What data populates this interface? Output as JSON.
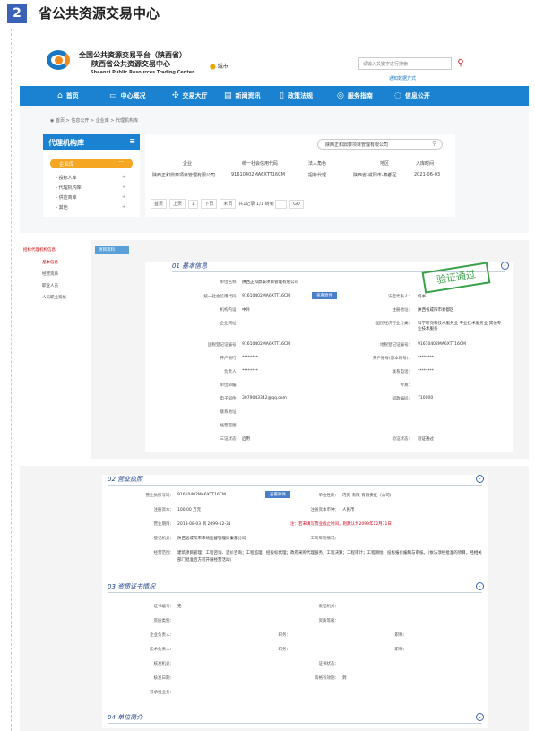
{
  "header": {
    "number": "2",
    "title": "省公共资源交易中心"
  },
  "site": {
    "org_line1": "全国公共资源交易平台（陕西省）",
    "org_line2": "陕西省公共资源交易中心",
    "org_en": "Shaanxi Public Resources Trading Center",
    "city": "城市",
    "search_placeholder": "请输入关键字进行搜索",
    "subscribe": "通知数据方式"
  },
  "nav": {
    "items": [
      {
        "icon": "home-icon",
        "label": "首页"
      },
      {
        "icon": "monitor-icon",
        "label": "中心概况"
      },
      {
        "icon": "handshake-icon",
        "label": "交易大厅"
      },
      {
        "icon": "document-icon",
        "label": "新闻资讯"
      },
      {
        "icon": "book-icon",
        "label": "政策法规"
      },
      {
        "icon": "compass-icon",
        "label": "服务指南"
      },
      {
        "icon": "chat-icon",
        "label": "信息公开"
      }
    ]
  },
  "breadcrumb": "首页 > 信息公开 > 企业库 > 代理机构库",
  "sidebar": {
    "title": "代理机构库",
    "active": "企业库",
    "items": [
      "投标人库",
      "代理机构库",
      "供应商库",
      "其他"
    ]
  },
  "list": {
    "search_value": "陕西正和鼎泰项目管理有限公司",
    "columns": [
      "企业",
      "统一社会信用代码",
      "法人角色",
      "地区",
      "入库时间"
    ],
    "row": [
      "陕西正和鼎泰项目管理有限公司",
      "91610402MA6XTT16CM",
      "招标代理",
      "陕西省-咸阳市-秦都区",
      "2021-06-03"
    ],
    "pager": [
      "首页",
      "上页",
      "1",
      "下页",
      "末页",
      "共1记录",
      "1/1",
      "转到",
      "GO"
    ]
  },
  "detail_side": {
    "title": "招标代理机构信息",
    "items": [
      "基本信息",
      "经营资质",
      "职业人员",
      "人员职业资格"
    ],
    "tab": "项目资料"
  },
  "basic": {
    "section": "01 基本信息",
    "stamp": "验证通过",
    "fields": [
      [
        "单位名称：",
        "陕西正和鼎泰项目管理有限公司"
      ],
      [
        "统一社会信用代码：",
        "91610402MA6XTT16CM"
      ],
      [
        "法定代表人：",
        "何书"
      ],
      [
        "机构内设：",
        "中外"
      ],
      [
        "注册地址：",
        "陕西省咸阳市秦都区"
      ],
      [
        "企业网址：",
        ""
      ],
      [
        "国民经济行业分类：",
        "科学研究和技术服务业-专业技术服务业-其他专业技术服务"
      ],
      [
        "国税登记证编号：",
        "91610402MA6XTT16CM"
      ],
      [
        "地税登记证编号：",
        "91610402MA6XTT16CM"
      ],
      [
        "开户银行：",
        "********"
      ],
      [
        "开户账号(基本账号)：",
        "********"
      ],
      [
        "负责人：",
        "********"
      ],
      [
        "联系电话：",
        "********"
      ],
      [
        "单位邮编：",
        ""
      ],
      [
        "传真：",
        ""
      ],
      [
        "电子邮件：",
        "3079043342@qq.com"
      ],
      [
        "邮政编码：",
        "710000"
      ],
      [
        "联系地址：",
        ""
      ],
      [
        "经营范围：",
        ""
      ],
      [
        "三证状态：",
        "启用"
      ],
      [
        "验证状态：",
        "验证通过"
      ]
    ],
    "view_button": "查看原件"
  },
  "license": {
    "section": "02 营业执照",
    "reg_no_label": "营业执照号码：",
    "reg_no": "91610402MA6XTT16CM",
    "view_button": "查看原件",
    "type_label": "单位性质：",
    "type": "内资-有限-有限责任（公司）",
    "capital_label": "注册资本：",
    "capital": "100.00 万元",
    "currency_label": "注册资本币种：",
    "currency": "人民币",
    "term_label": "营业期限：",
    "term": "2018-08-03  到  2099-12-31",
    "term_note": "注：若未填写营业截止时间，则默认为2099年12月31日",
    "authority_label": "登记机关：",
    "authority": "陕西省咸阳市市场监督管理局秦都分局",
    "sub_label": "工商年检情况：",
    "scope_label": "经营范围：",
    "scope": "建筑项目管理；工程咨询、造价咨询；工程监理；招投标代理；政府采购代理服务；工程决算；工程审计；工程测绘。投标报价编制与审核。（依法须经批准的项目，经相关部门批准后方可开展经营活动）"
  },
  "qual": {
    "section": "03 资质证书情况",
    "rows": [
      [
        "证书编号：",
        "无",
        "发证机关：",
        ""
      ],
      [
        "资质类别：",
        "",
        "资质等级：",
        ""
      ],
      [
        "企业负责人：",
        "",
        "职务：",
        "",
        "职称：",
        ""
      ],
      [
        "技术负责人：",
        "",
        "职务：",
        "",
        "职称：",
        ""
      ],
      [
        "核发机关：",
        "",
        "证书状态：",
        ""
      ],
      [
        "核发日期：",
        "",
        "资格有效期：",
        "到"
      ],
      [
        "可承担业务：",
        ""
      ]
    ]
  },
  "intro": {
    "section": "04 单位简介"
  }
}
